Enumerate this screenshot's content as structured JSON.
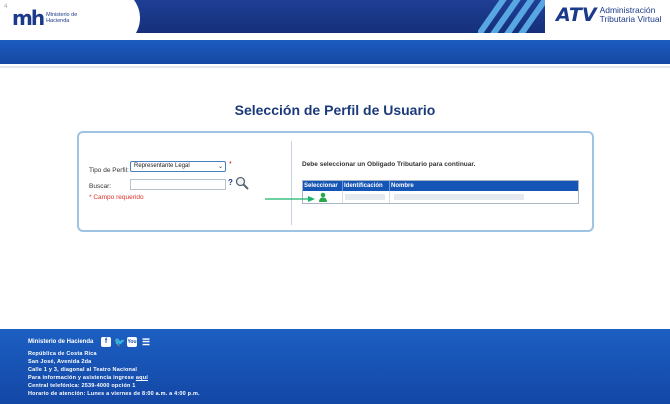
{
  "header": {
    "page_number": "4",
    "mh_logo_mark": "mh",
    "mh_logo_text": "Ministerio de Hacienda",
    "atv_logo_mark": "ATV",
    "atv_logo_line1": "Administración",
    "atv_logo_line2": "Tributaria Virtual"
  },
  "main": {
    "title": "Selección de Perfil de Usuario",
    "tipo_perfil_label": "Tipo de Perfil:",
    "perfil_selected": "Representante Legal",
    "required_marker": "*",
    "buscar_label": "Buscar:",
    "buscar_value": "",
    "help_mark": "?",
    "campo_requerido": "* Campo requerido",
    "right_message": "Debe seleccionar un Obligado Tributario para continuar.",
    "grid": {
      "columns": [
        "Seleccionar",
        "Identificación",
        "Nombre"
      ]
    }
  },
  "footer": {
    "title": "Ministerio de Hacienda",
    "social_icons": [
      "facebook-icon",
      "twitter-icon",
      "youtube-icon",
      "list-icon"
    ],
    "fb_glyph": "f",
    "tw_glyph": "🐦",
    "yt_glyph": "You",
    "list_glyph": "☰",
    "line1": "República de Costa Rica",
    "line2": "San José, Avenida 2da",
    "line3": "Calle 1 y 3, diagonal al Teatro Nacional",
    "line4_text": "Para información y asistencia ingrese ",
    "line4_link": "aquí",
    "line5": "Central telefónica: 2539-4000 opción 1",
    "line6": "Horario de atención: Lunes a viernes de 8:00 a.m. a 4:00 p.m."
  },
  "colors": {
    "brand_blue": "#1b3a8a",
    "nav_blue": "#1d5cc0",
    "required_red": "#e0302a",
    "pointer_green": "#19b36b"
  }
}
